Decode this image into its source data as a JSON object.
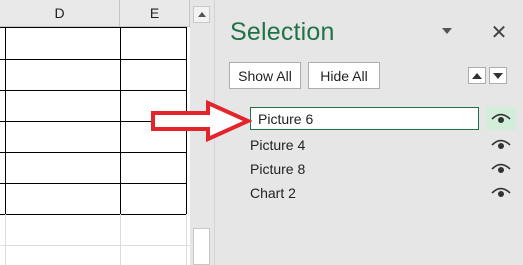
{
  "sheet": {
    "columns": [
      "D",
      "E"
    ]
  },
  "pane": {
    "title": "Selection",
    "show_all": "Show All",
    "hide_all": "Hide All",
    "items": [
      {
        "label": "Picture 6",
        "selected": true
      },
      {
        "label": "Picture 4",
        "selected": false
      },
      {
        "label": "Picture 8",
        "selected": false
      },
      {
        "label": "Chart 2",
        "selected": false
      }
    ],
    "close_glyph": "✕"
  },
  "colors": {
    "accent": "#217346",
    "callout": "#e3242b",
    "pane_bg": "#e6e6e6"
  },
  "icons": {
    "visibility": "eye-icon",
    "callout": "red-arrow-icon"
  }
}
